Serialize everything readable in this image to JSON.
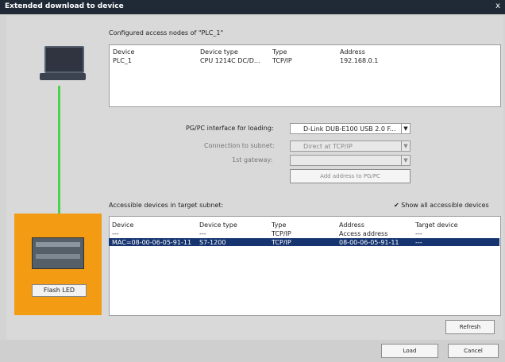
{
  "window": {
    "title": "Extended download to device",
    "close": "x"
  },
  "configured": {
    "heading": "Configured access nodes of \"PLC_1\"",
    "headers": [
      "Device",
      "Device type",
      "Type",
      "Address"
    ],
    "row": [
      "PLC_1",
      "CPU 1214C DC/D...",
      "TCP/IP",
      "192.168.0.1"
    ]
  },
  "interface": {
    "label": "PG/PC interface for loading:",
    "value": "D-Link DUB-E100 USB 2.0 F...",
    "connection_label": "Connection to subnet:",
    "connection_value": "Direct at TCP/IP",
    "gateway_label": "1st gateway:",
    "gateway_value": "",
    "add_button": "Add address to PG/PC"
  },
  "accessible": {
    "heading": "Accessible devices in target subnet:",
    "show_all_label": "Show all accessible devices",
    "headers": [
      "Device",
      "Device type",
      "Type",
      "Address",
      "Target device"
    ],
    "rows": [
      [
        "---",
        "---",
        "TCP/IP",
        "Access address",
        "---"
      ],
      [
        "MAC=08-00-06-05-91-11",
        "S7-1200",
        "TCP/IP",
        "08-00-06-05-91-11",
        "---"
      ]
    ]
  },
  "plc": {
    "flash_label": "Flash LED"
  },
  "buttons": {
    "refresh": "Refresh",
    "load": "Load",
    "cancel": "Cancel"
  }
}
